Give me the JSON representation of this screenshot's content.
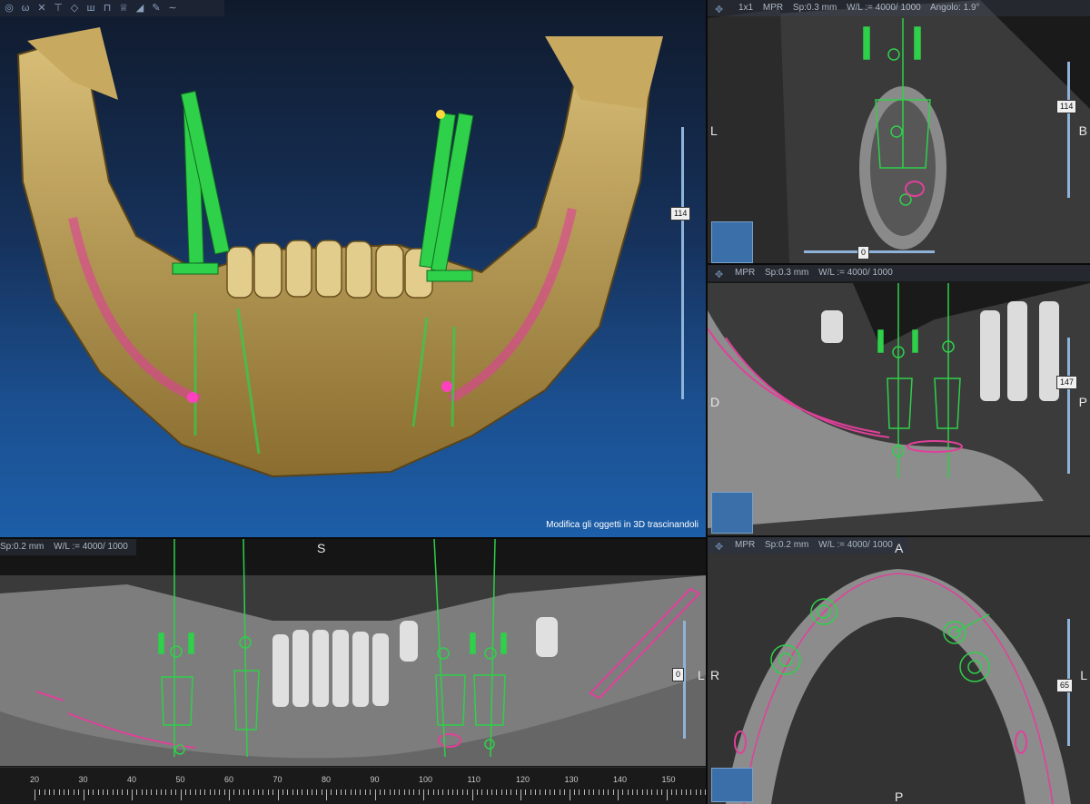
{
  "toolbar": {
    "icons": [
      "sphere-tool-icon",
      "tooth-tool-icon",
      "cross-tool-icon",
      "implant-tool-icon",
      "shovel-tool-icon",
      "multi-tooth-tool-icon",
      "arch-tool-icon",
      "crown-tool-icon",
      "measure-tool-icon",
      "pen-tool-icon",
      "curve-tool-icon"
    ]
  },
  "view3d": {
    "hint": "Modifica gli oggetti in 3D trascinandoli",
    "slider_value": "114"
  },
  "axial": {
    "layout": "1x1",
    "mode": "MPR",
    "spacing": "Sp:0.3 mm",
    "window": "W/L := 4000/ 1000",
    "angle": "Angolo: 1.9°",
    "left_label": "L",
    "right_label": "B",
    "slider_value": "114",
    "hslider_value": "0"
  },
  "sagittal": {
    "mode": "MPR",
    "spacing": "Sp:0.3 mm",
    "window": "W/L := 4000/ 1000",
    "left_label": "D",
    "right_label": "P",
    "slider_value": "147"
  },
  "panoramic": {
    "spacing": "Sp:0.2 mm",
    "window": "W/L := 4000/ 1000",
    "top_label": "S",
    "right_label": "L",
    "slider_value": "0",
    "ruler": [
      "20",
      "30",
      "40",
      "50",
      "60",
      "70",
      "80",
      "90",
      "100",
      "110",
      "120",
      "130",
      "140",
      "150"
    ]
  },
  "coronal": {
    "mode": "MPR",
    "spacing": "Sp:0.2 mm",
    "window": "W/L := 4000/ 1000",
    "top_label": "A",
    "left_label": "R",
    "right_label": "L",
    "bottom_label": "P",
    "slider_value": "65"
  },
  "colors": {
    "implant": "#2fd04a",
    "nerve": "#e0409a",
    "bone": "#b79a56",
    "accent": "#8fb3d8"
  }
}
